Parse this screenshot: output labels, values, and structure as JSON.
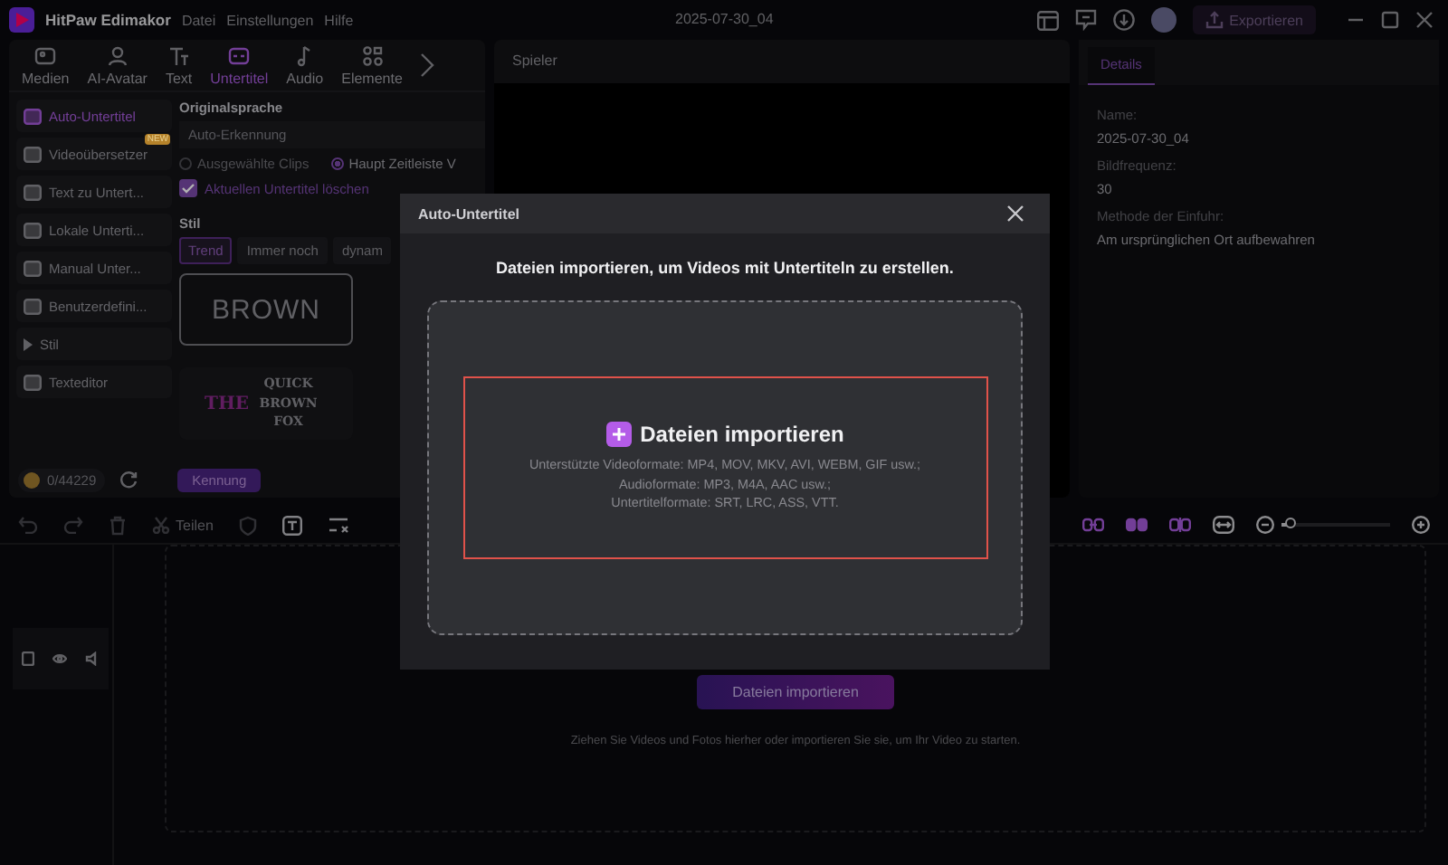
{
  "app": {
    "name": "HitPaw Edimakor",
    "menu": [
      "Datei",
      "Einstellungen",
      "Hilfe"
    ],
    "project_title": "2025-07-30_04",
    "export_button": "Exportieren"
  },
  "media_tabs": [
    {
      "label": "Medien",
      "selected": false
    },
    {
      "label": "AI-Avatar",
      "selected": false
    },
    {
      "label": "Text",
      "selected": false
    },
    {
      "label": "Untertitel",
      "selected": true
    },
    {
      "label": "Audio",
      "selected": false
    },
    {
      "label": "Elemente",
      "selected": false
    }
  ],
  "sidebar": {
    "items": [
      {
        "label": "Auto-Untertitel",
        "selected": true,
        "kind": "item"
      },
      {
        "label": "Videoübersetzer",
        "selected": false,
        "kind": "item",
        "badge": "NEW"
      },
      {
        "label": "Text zu Untert...",
        "selected": false,
        "kind": "item"
      },
      {
        "label": "Lokale Unterti...",
        "selected": false,
        "kind": "item"
      },
      {
        "label": "Manual Unter...",
        "selected": false,
        "kind": "item"
      },
      {
        "label": "Benutzerdefini...",
        "selected": false,
        "kind": "item"
      },
      {
        "label": "Stil",
        "selected": false,
        "kind": "group"
      },
      {
        "label": "Texteditor",
        "selected": false,
        "kind": "item"
      }
    ]
  },
  "subtitle_panel": {
    "language_label": "Originalsprache",
    "language_value": "Auto-Erkennung",
    "scope_options": [
      {
        "label": "Ausgewählte Clips",
        "selected": false
      },
      {
        "label": "Haupt Zeitleiste V",
        "selected": true
      }
    ],
    "clear_option": {
      "label": "Aktuellen Untertitel löschen",
      "checked": true
    },
    "style_label": "Stil",
    "style_tabs": [
      {
        "label": "Trend",
        "selected": true
      },
      {
        "label": "Immer noch",
        "selected": false
      },
      {
        "label": "dynam",
        "selected": false
      }
    ],
    "style_presets": [
      {
        "kind": "outline",
        "text": "BROWN"
      },
      {
        "kind": "classic",
        "accent": "THE",
        "text": "QUICK BROWN FOX"
      }
    ],
    "credits": "0/44229",
    "recognize_button": "Kennung"
  },
  "player": {
    "title": "Spieler"
  },
  "details": {
    "tabs": [
      {
        "label": "Details",
        "selected": true
      }
    ],
    "fields": [
      {
        "label": "Name:",
        "value": "2025-07-30_04"
      },
      {
        "label": "Bildfrequenz:",
        "value": "30"
      },
      {
        "label": "Methode der Einfuhr:",
        "value": "Am ursprünglichen Ort aufbewahren"
      }
    ]
  },
  "timeline": {
    "split_label": "Teilen",
    "zoom": {
      "level": 0.08
    },
    "import_button": "Dateien importieren",
    "hint": "Ziehen Sie Videos und Fotos hierher oder importieren Sie sie, um Ihr Video zu starten."
  },
  "dialog": {
    "title": "Auto-Untertitel",
    "heading": "Dateien importieren, um Videos mit Untertiteln zu erstellen.",
    "import_label": "Dateien importieren",
    "formats": [
      "Unterstützte Videoformate: MP4, MOV, MKV, AVI, WEBM, GIF usw.;",
      "Audioformate: MP3, M4A, AAC usw.;",
      "Untertitelformate: SRT, LRC, ASS, VTT."
    ]
  }
}
